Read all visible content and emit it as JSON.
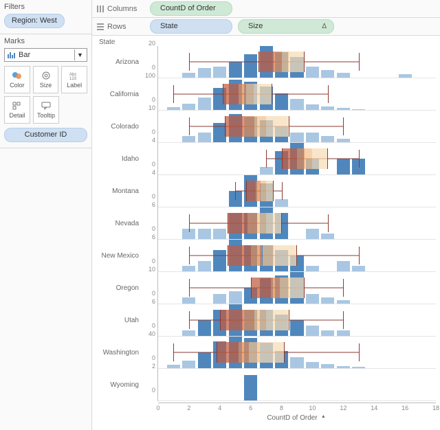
{
  "filters": {
    "title": "Filters",
    "pill": "Region: West"
  },
  "marks": {
    "title": "Marks",
    "dropdown": "Bar",
    "buttons": [
      "Color",
      "Size",
      "Label",
      "Detail",
      "Tooltip"
    ],
    "customer_pill": "Customer ID"
  },
  "shelves": {
    "columns_label": "Columns",
    "columns_pill": "CountD of Order",
    "rows_label": "Rows",
    "rows_pills": [
      "State",
      "Size"
    ],
    "delta": "Δ"
  },
  "chart": {
    "state_header": "State",
    "xlabel": "CountD of Order",
    "xmin": 0,
    "xmax": 18,
    "xticks": [
      0,
      2,
      4,
      6,
      8,
      10,
      12,
      14,
      16,
      18
    ]
  },
  "chart_data": {
    "type": "bar",
    "xlabel": "CountD of Order",
    "facet_field": "State",
    "facets": [
      {
        "state": "Arizona",
        "ymax": 20,
        "yticks": [
          0,
          20
        ],
        "bars": [
          [
            2,
            3
          ],
          [
            3,
            6
          ],
          [
            4,
            7
          ],
          [
            5,
            10
          ],
          [
            6,
            15
          ],
          [
            7,
            20
          ],
          [
            8,
            16
          ],
          [
            9,
            13
          ],
          [
            10,
            7
          ],
          [
            11,
            5
          ],
          [
            12,
            3
          ],
          [
            16,
            2
          ]
        ],
        "box": {
          "wlo": 2,
          "q1": 6.5,
          "q2": 7.5,
          "q3": 8.5,
          "q4": 9.5,
          "whi": 13
        }
      },
      {
        "state": "California",
        "ymax": 100,
        "yticks": [
          0,
          100
        ],
        "bars": [
          [
            1,
            8
          ],
          [
            2,
            20
          ],
          [
            3,
            40
          ],
          [
            4,
            70
          ],
          [
            5,
            95
          ],
          [
            6,
            90
          ],
          [
            7,
            75
          ],
          [
            8,
            52
          ],
          [
            9,
            35
          ],
          [
            10,
            18
          ],
          [
            11,
            10
          ],
          [
            12,
            6
          ],
          [
            13,
            3
          ]
        ],
        "box": {
          "wlo": 1,
          "q1": 4.2,
          "q2": 5.2,
          "q3": 6.2,
          "q4": 7.4,
          "whi": 11
        }
      },
      {
        "state": "Colorado",
        "ymax": 10,
        "yticks": [
          0,
          10
        ],
        "bars": [
          [
            2,
            2
          ],
          [
            3,
            3
          ],
          [
            4,
            6
          ],
          [
            5,
            9
          ],
          [
            6,
            8
          ],
          [
            7,
            7
          ],
          [
            8,
            5
          ],
          [
            9,
            3
          ],
          [
            10,
            3
          ],
          [
            11,
            2
          ],
          [
            12,
            1
          ]
        ],
        "box": {
          "wlo": 2,
          "q1": 4.3,
          "q2": 5.5,
          "q3": 7,
          "q4": 8.5,
          "whi": 12
        }
      },
      {
        "state": "Idaho",
        "ymax": 4,
        "yticks": [
          0,
          4
        ],
        "bars": [
          [
            7,
            1
          ],
          [
            8,
            3
          ],
          [
            9,
            4
          ],
          [
            10,
            2
          ],
          [
            12,
            2
          ],
          [
            13,
            2
          ]
        ],
        "box": {
          "wlo": 7,
          "q1": 8,
          "q2": 9,
          "q3": 10,
          "q4": 11,
          "whi": 13
        }
      },
      {
        "state": "Montana",
        "ymax": 4,
        "yticks": [
          0,
          4
        ],
        "bars": [
          [
            5,
            2
          ],
          [
            6,
            4
          ],
          [
            7,
            3
          ],
          [
            8,
            1
          ]
        ],
        "box": {
          "wlo": 5,
          "q1": 5.7,
          "q2": 6.3,
          "q3": 7,
          "q4": 7.5,
          "whi": 8
        }
      },
      {
        "state": "Nevada",
        "ymax": 6,
        "yticks": [
          0,
          6
        ],
        "bars": [
          [
            2,
            2
          ],
          [
            3,
            2
          ],
          [
            4,
            2
          ],
          [
            5,
            5
          ],
          [
            6,
            5
          ],
          [
            7,
            6
          ],
          [
            8,
            5
          ],
          [
            10,
            2
          ],
          [
            11,
            1
          ]
        ],
        "box": {
          "wlo": 2,
          "q1": 4.5,
          "q2": 5.8,
          "q3": 7,
          "q4": 8,
          "whi": 11
        }
      },
      {
        "state": "New Mexico",
        "ymax": 6,
        "yticks": [
          0,
          6
        ],
        "bars": [
          [
            2,
            1
          ],
          [
            3,
            2
          ],
          [
            4,
            4
          ],
          [
            5,
            6
          ],
          [
            6,
            5
          ],
          [
            7,
            5
          ],
          [
            8,
            4
          ],
          [
            9,
            3
          ],
          [
            10,
            1
          ],
          [
            12,
            2
          ],
          [
            13,
            1
          ]
        ],
        "box": {
          "wlo": 2,
          "q1": 4.5,
          "q2": 6,
          "q3": 7.5,
          "q4": 9,
          "whi": 13
        }
      },
      {
        "state": "Oregon",
        "ymax": 10,
        "yticks": [
          0,
          10
        ],
        "bars": [
          [
            2,
            2
          ],
          [
            4,
            3
          ],
          [
            5,
            4
          ],
          [
            6,
            5
          ],
          [
            7,
            8
          ],
          [
            8,
            9
          ],
          [
            9,
            10
          ],
          [
            10,
            3
          ],
          [
            11,
            2
          ],
          [
            12,
            1
          ]
        ],
        "box": {
          "wlo": 2,
          "q1": 6,
          "q2": 7.3,
          "q3": 8.5,
          "q4": 9.5,
          "whi": 12
        }
      },
      {
        "state": "Utah",
        "ymax": 6,
        "yticks": [
          0,
          6
        ],
        "bars": [
          [
            2,
            1
          ],
          [
            3,
            3
          ],
          [
            4,
            5
          ],
          [
            5,
            6
          ],
          [
            6,
            5
          ],
          [
            7,
            5
          ],
          [
            8,
            4
          ],
          [
            9,
            3
          ],
          [
            10,
            2
          ],
          [
            11,
            1
          ],
          [
            12,
            1
          ]
        ],
        "box": {
          "wlo": 2,
          "q1": 4,
          "q2": 5.5,
          "q3": 7,
          "q4": 8.5,
          "whi": 12
        }
      },
      {
        "state": "Washington",
        "ymax": 40,
        "yticks": [
          0,
          40
        ],
        "bars": [
          [
            1,
            4
          ],
          [
            2,
            10
          ],
          [
            3,
            20
          ],
          [
            4,
            34
          ],
          [
            5,
            40
          ],
          [
            6,
            38
          ],
          [
            7,
            32
          ],
          [
            8,
            22
          ],
          [
            9,
            14
          ],
          [
            10,
            8
          ],
          [
            11,
            5
          ],
          [
            12,
            3
          ],
          [
            13,
            2
          ]
        ],
        "box": {
          "wlo": 1,
          "q1": 3.8,
          "q2": 5.2,
          "q3": 6.6,
          "q4": 8.2,
          "whi": 13
        }
      },
      {
        "state": "Wyoming",
        "ymax": 2,
        "yticks": [
          0,
          2
        ],
        "bars": [
          [
            6,
            1.6
          ]
        ],
        "box": null
      }
    ]
  }
}
